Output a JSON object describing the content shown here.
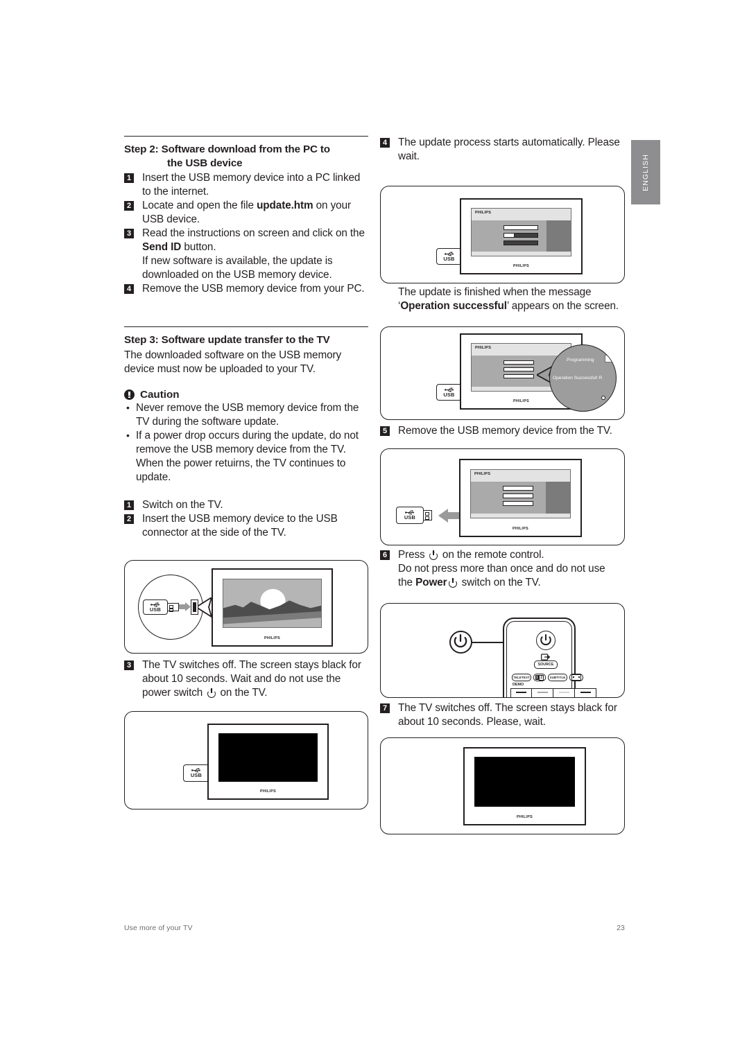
{
  "document": {
    "page_number": "23",
    "footer_label": "Use more of your TV",
    "language_tab": "ENGLISH"
  },
  "left_column": {
    "step2": {
      "title_line1": "Step 2: Software download from the PC to",
      "title_line2": "the USB device",
      "items": [
        {
          "num": "1",
          "text": "Insert the USB memory device into a PC linked to the internet."
        },
        {
          "num": "2",
          "text_before": "Locate and open the file ",
          "bold": "update.htm",
          "text_after": " on your USB device."
        },
        {
          "num": "3",
          "text_before": "Read the instructions on screen and click on the ",
          "bold": "Send ID",
          "text_after": " button.",
          "continuation": "If new software is available, the update is downloaded on the USB memory device."
        },
        {
          "num": "4",
          "text": "Remove the USB memory device from your PC."
        }
      ]
    },
    "step3": {
      "title": "Step 3: Software update transfer to the TV",
      "intro": "The downloaded software on the USB memory device must now be uploaded to your TV.",
      "caution_title": "Caution",
      "caution_bullets": [
        "Never remove the USB memory device from the TV during the software update.",
        "If a power drop occurs during the update, do not remove the USB memory device from the TV. When the power retuirns, the TV continues to update."
      ],
      "items": [
        {
          "num": "1",
          "text": "Switch on the TV."
        },
        {
          "num": "2",
          "text": "Insert the USB memory device to the USB connector at the side of the TV."
        }
      ],
      "item3": {
        "num": "3",
        "text_before": "The TV switches off. The screen stays black for about 10 seconds. Wait and do not use the power switch ",
        "text_after": " on the TV."
      }
    },
    "figure_usb_insert": {
      "usb_label": "USB",
      "socket_label": "USB",
      "tv_logo": "PHILIPS"
    },
    "figure_tv_black": {
      "usb_label": "USB",
      "tv_logo": "PHILIPS"
    }
  },
  "right_column": {
    "step4": {
      "num": "4",
      "text": "The update process starts automatically. Please wait."
    },
    "figure_updating": {
      "usb_label": "USB",
      "osd_brand": "PHILIPS",
      "tv_logo": "PHILIPS"
    },
    "after_update": {
      "line1": "The update is finished when the message",
      "quote_open": "‘",
      "bold": "Operation successful",
      "quote_close": "’",
      "line2_after": " appears on the screen."
    },
    "figure_success": {
      "usb_label": "USB",
      "osd_brand": "PHILIPS",
      "tv_logo": "PHILIPS",
      "bubble_line1": "Programming",
      "bubble_line2": "Operation Successful! R"
    },
    "step5": {
      "num": "5",
      "text": "Remove the USB memory device from the TV."
    },
    "figure_remove_usb": {
      "usb_label": "USB",
      "osd_brand": "PHILIPS",
      "tv_logo": "PHILIPS"
    },
    "step6": {
      "num": "6",
      "text_before": "Press ",
      "text_mid": " on the remote control.",
      "line2": "Do not press more than once and do not use",
      "line3_before": "the ",
      "line3_bold": "Power",
      "line3_after": " switch on the TV."
    },
    "figure_remote": {
      "source_label": "SOURCE",
      "teletext_label": "TELETEXT",
      "dualscreen_label": "12",
      "subtitle_label": "SUBTITLE",
      "format_label": "",
      "demo_label": "DEMO"
    },
    "step7": {
      "num": "7",
      "text": "The TV switches off. The screen stays black for about 10 seconds. Please, wait."
    },
    "figure_tv_black_right": {
      "tv_logo": "PHILIPS"
    }
  }
}
